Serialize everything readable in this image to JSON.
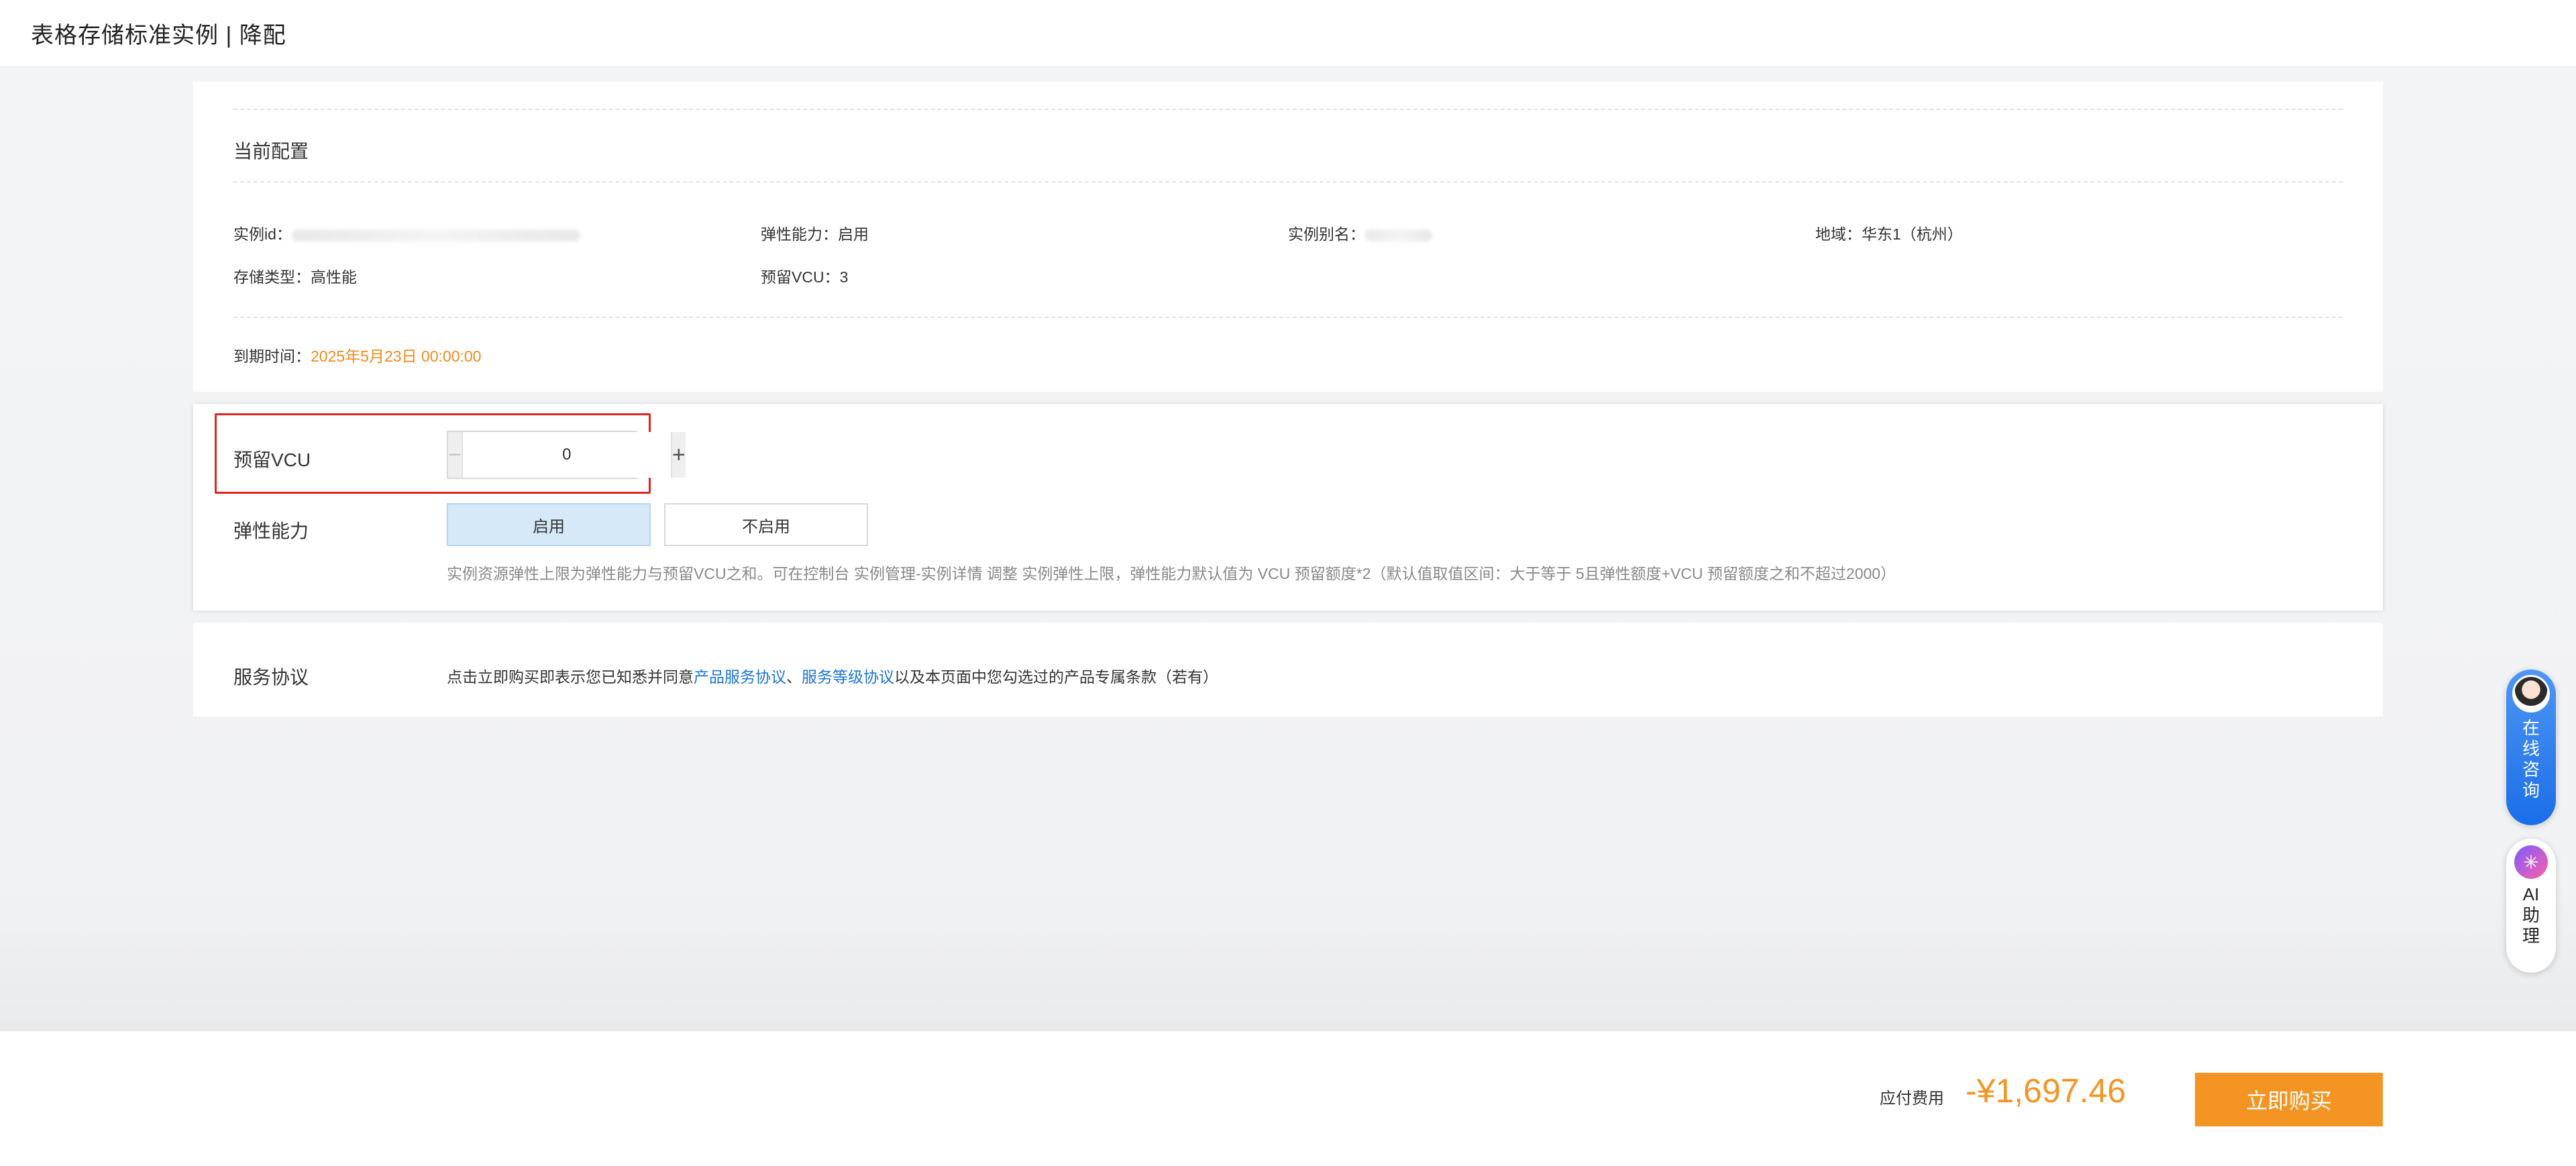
{
  "header": {
    "title": "表格存储标准实例 | 降配"
  },
  "current_config": {
    "title": "当前配置",
    "instance_id_label": "实例id：",
    "elastic_label": "弹性能力：",
    "elastic_value": "启用",
    "alias_label": "实例别名：",
    "region_label": "地域：",
    "region_value": "华东1（杭州）",
    "storage_label": "存储类型：",
    "storage_value": "高性能",
    "reserved_vcu_label": "预留VCU：",
    "reserved_vcu_value": "3",
    "expire_label": "到期时间：",
    "expire_value": "2025年5月23日 00:00:00"
  },
  "form": {
    "vcu_label": "预留VCU",
    "vcu_value": "0",
    "minus": "−",
    "plus": "+",
    "elastic_label": "弹性能力",
    "option_on": "启用",
    "option_off": "不启用",
    "hint": "实例资源弹性上限为弹性能力与预留VCU之和。可在控制台 实例管理-实例详情 调整 实例弹性上限，弹性能力默认值为 VCU 预留额度*2（默认值取值区间：大于等于 5且弹性额度+VCU 预留额度之和不超过2000）"
  },
  "agreement": {
    "label": "服务协议",
    "text_prefix": "点击立即购买即表示您已知悉并同意",
    "link1": "产品服务协议",
    "sep": "、",
    "link2": "服务等级协议",
    "text_suffix": "以及本页面中您勾选过的产品专属条款（若有）"
  },
  "footer": {
    "fee_label": "应付费用",
    "fee_value": "-¥1,697.46",
    "buy_label": "立即购买"
  },
  "widgets": {
    "consult_text": "在线咨询",
    "ai_text": "AI助理"
  },
  "colors": {
    "accent_orange": "#f39423",
    "link_blue": "#1a75d2",
    "highlight_red": "#e02424"
  }
}
